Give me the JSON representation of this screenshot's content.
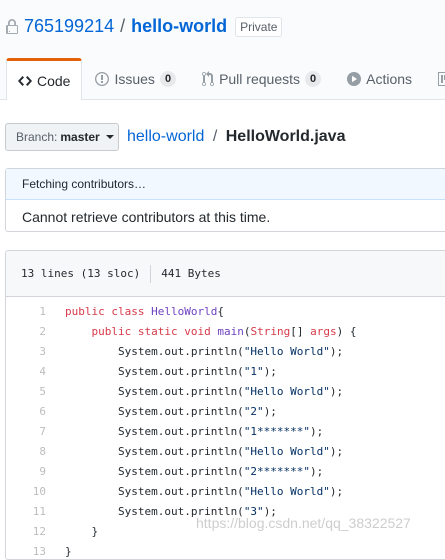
{
  "repo": {
    "owner": "765199214",
    "separator": "/",
    "name": "hello-world",
    "visibility": "Private"
  },
  "tabs": [
    {
      "label": "Code",
      "icon": "code-icon",
      "selected": true
    },
    {
      "label": "Issues",
      "icon": "issue-icon",
      "count": "0"
    },
    {
      "label": "Pull requests",
      "icon": "pull-request-icon",
      "count": "0"
    },
    {
      "label": "Actions",
      "icon": "play-icon"
    },
    {
      "label": "P",
      "icon": "project-icon"
    }
  ],
  "branch": {
    "label": "Branch:",
    "value": "master"
  },
  "breadcrumb": {
    "repo": "hello-world",
    "separator": "/",
    "file": "HelloWorld.java"
  },
  "contributors": {
    "status": "Fetching contributors…",
    "message": "Cannot retrieve contributors at this time."
  },
  "file": {
    "lines_info": "13 lines (13 sloc)",
    "size": "441 Bytes",
    "lines": [
      {
        "n": "1",
        "parts": [
          [
            "k",
            "public class "
          ],
          [
            "t",
            "HelloWorld"
          ],
          [
            "",
            "{"
          ]
        ]
      },
      {
        "n": "2",
        "parts": [
          [
            "",
            "    "
          ],
          [
            "k",
            "public static void "
          ],
          [
            "t",
            "main"
          ],
          [
            "",
            "("
          ],
          [
            "k",
            "String"
          ],
          [
            "",
            "[] "
          ],
          [
            "k",
            "args"
          ],
          [
            "",
            ") {"
          ]
        ]
      },
      {
        "n": "3",
        "parts": [
          [
            "",
            "        System.out.println("
          ],
          [
            "s",
            "\"Hello World\""
          ],
          [
            "",
            ");"
          ]
        ]
      },
      {
        "n": "4",
        "parts": [
          [
            "",
            "        System.out.println("
          ],
          [
            "s",
            "\"1\""
          ],
          [
            "",
            ");"
          ]
        ]
      },
      {
        "n": "5",
        "parts": [
          [
            "",
            "        System.out.println("
          ],
          [
            "s",
            "\"Hello World\""
          ],
          [
            "",
            ");"
          ]
        ]
      },
      {
        "n": "6",
        "parts": [
          [
            "",
            "        System.out.println("
          ],
          [
            "s",
            "\"2\""
          ],
          [
            "",
            ");"
          ]
        ]
      },
      {
        "n": "7",
        "parts": [
          [
            "",
            "        System.out.println("
          ],
          [
            "s",
            "\"1*******\""
          ],
          [
            "",
            ");"
          ]
        ]
      },
      {
        "n": "8",
        "parts": [
          [
            "",
            "        System.out.println("
          ],
          [
            "s",
            "\"Hello World\""
          ],
          [
            "",
            ");"
          ]
        ]
      },
      {
        "n": "9",
        "parts": [
          [
            "",
            "        System.out.println("
          ],
          [
            "s",
            "\"2*******\""
          ],
          [
            "",
            ");"
          ]
        ]
      },
      {
        "n": "10",
        "parts": [
          [
            "",
            "        System.out.println("
          ],
          [
            "s",
            "\"Hello World\""
          ],
          [
            "",
            ");"
          ]
        ]
      },
      {
        "n": "11",
        "parts": [
          [
            "",
            "        System.out.println("
          ],
          [
            "s",
            "\"3\""
          ],
          [
            "",
            ");"
          ]
        ]
      },
      {
        "n": "12",
        "parts": [
          [
            "",
            "    }"
          ]
        ]
      },
      {
        "n": "13",
        "parts": [
          [
            "",
            "}"
          ]
        ]
      }
    ]
  },
  "watermark": "https://blog.csdn.net/qq_38322527"
}
